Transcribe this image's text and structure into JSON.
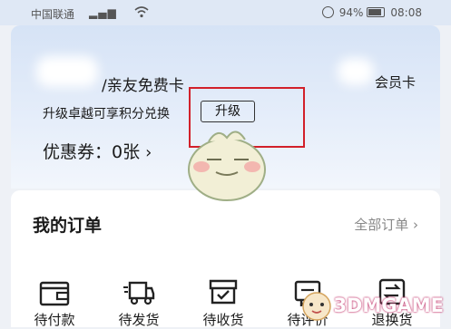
{
  "status_bar": {
    "carrier": "中国联通",
    "signal": "⁴ᴳ",
    "battery": "94%",
    "time": "08:08"
  },
  "card": {
    "name": "/亲友免费卡",
    "member_label": "会员卡",
    "upgrade_text": "升级卓越可享积分兑换",
    "upgrade_button": "升级",
    "coupons_label": "优惠券：",
    "coupons_value": "0张",
    "coupons_chevron": "›"
  },
  "orders": {
    "title": "我的订单",
    "all_label": "全部订单 ›",
    "items": [
      {
        "label": "待付款",
        "icon": "wallet-icon"
      },
      {
        "label": "待发货",
        "icon": "truck-icon"
      },
      {
        "label": "待收货",
        "icon": "box-icon"
      },
      {
        "label": "待评价",
        "icon": "review-icon"
      },
      {
        "label": "退换货",
        "icon": "exchange-icon"
      }
    ]
  },
  "watermark": {
    "text": "3DMGAME"
  },
  "colors": {
    "highlight": "#d2202a",
    "card_bg": "#dfe8f5"
  }
}
